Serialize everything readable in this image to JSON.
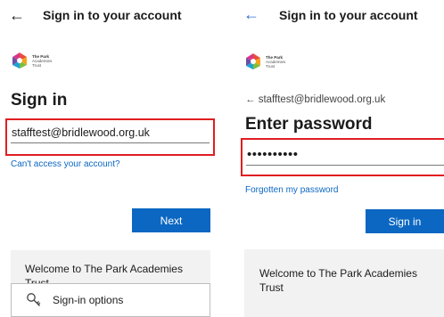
{
  "left": {
    "header_title": "Sign in to your account",
    "logo_lines": [
      "The Park",
      "Academies",
      "Trust"
    ],
    "heading": "Sign in",
    "email_value": "stafftest@bridlewood.org.uk",
    "cant_access_link": "Can't access your account?",
    "next_button": "Next",
    "welcome_text": "Welcome to The Park Academies Trust",
    "signin_options": "Sign-in options"
  },
  "right": {
    "header_title": "Sign in to your account",
    "logo_lines": [
      "The Park",
      "Academies",
      "Trust"
    ],
    "back_email": "← stafftest@bridlewood.org.uk",
    "heading": "Enter password",
    "password_value": "••••••••••",
    "forgot_link": "Forgotten my password",
    "signin_button": "Sign in",
    "welcome_text": "Welcome to The Park Academies Trust"
  },
  "colors": {
    "accent_blue": "#0b67c2",
    "highlight_red": "#e01e22",
    "welcome_bg": "#f2f2f2"
  },
  "icons": {
    "back": "back-arrow-icon",
    "options": "key-search-icon"
  }
}
